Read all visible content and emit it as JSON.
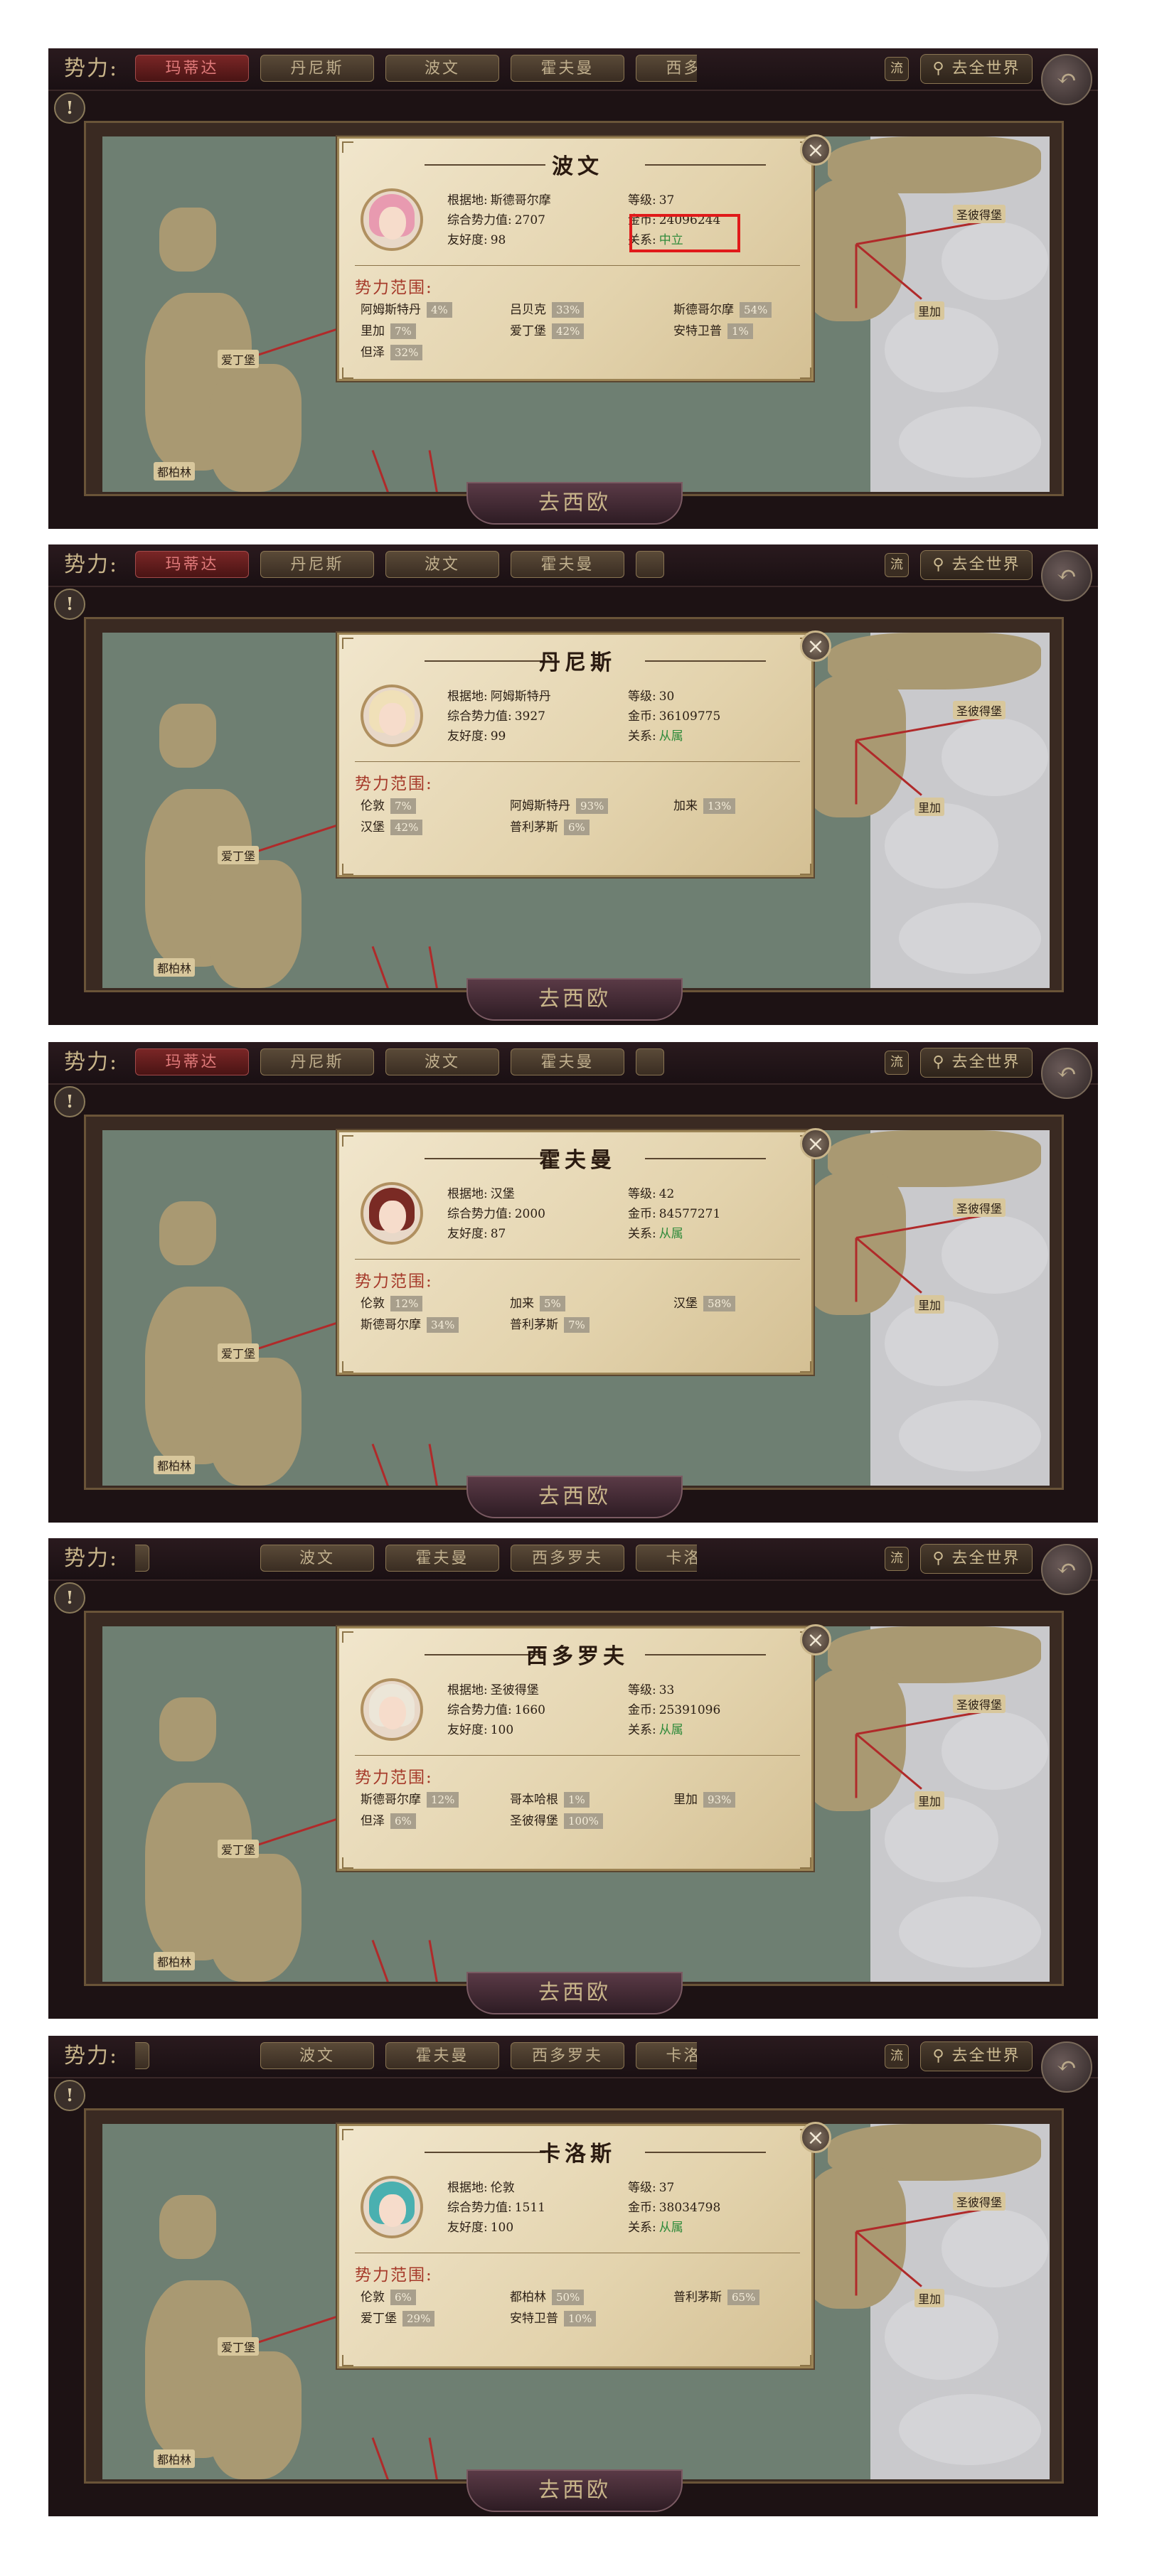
{
  "common": {
    "faction_label": "势力:",
    "small_btn": "流",
    "world_btn": "去全世界",
    "go_btn": "去西欧",
    "range_title": "势力范围:",
    "close_icon": "close-icon",
    "back_icon": "back-arrow-icon",
    "alert_icon": "alert-icon",
    "colors": {
      "relation": "#2e8a3a",
      "highlight": "#e01a1a",
      "active_tab": "#e07a7a"
    }
  },
  "map_labels": [
    "爱丁堡",
    "都柏林",
    "圣彼得堡",
    "里加"
  ],
  "panels": [
    {
      "tabs": [
        {
          "label": "玛蒂达",
          "active": true
        },
        {
          "label": "丹尼斯"
        },
        {
          "label": "波文"
        },
        {
          "label": "霍夫曼"
        },
        {
          "label": "西多罗"
        }
      ],
      "dialog": {
        "name": "波文",
        "base_label": "根据地:",
        "base": "斯德哥尔摩",
        "power_label": "综合势力值:",
        "power": "2707",
        "friend_label": "友好度:",
        "friend": "98",
        "level_label": "等级:",
        "level": "37",
        "gold_label": "金币:",
        "gold": "24096244",
        "relation_label": "关系:",
        "relation": "中立",
        "highlight_relation": true,
        "ranges": [
          {
            "name": "阿姆斯特丹",
            "pct": "4%"
          },
          {
            "name": "吕贝克",
            "pct": "33%"
          },
          {
            "name": "斯德哥尔摩",
            "pct": "54%"
          },
          {
            "name": "里加",
            "pct": "7%"
          },
          {
            "name": "爱丁堡",
            "pct": "42%"
          },
          {
            "name": "安特卫普",
            "pct": "1%"
          },
          {
            "name": "但泽",
            "pct": "32%"
          }
        ]
      }
    },
    {
      "tabs": [
        {
          "label": "玛蒂达",
          "active": true
        },
        {
          "label": "丹尼斯"
        },
        {
          "label": "波文"
        },
        {
          "label": "霍夫曼"
        },
        {
          "label": ""
        }
      ],
      "dialog": {
        "name": "丹尼斯",
        "base_label": "根据地:",
        "base": "阿姆斯特丹",
        "power_label": "综合势力值:",
        "power": "3927",
        "friend_label": "友好度:",
        "friend": "99",
        "level_label": "等级:",
        "level": "30",
        "gold_label": "金币:",
        "gold": "36109775",
        "relation_label": "关系:",
        "relation": "从属",
        "highlight_relation": false,
        "ranges": [
          {
            "name": "伦敦",
            "pct": "7%"
          },
          {
            "name": "阿姆斯特丹",
            "pct": "93%"
          },
          {
            "name": "加来",
            "pct": "13%"
          },
          {
            "name": "汉堡",
            "pct": "42%"
          },
          {
            "name": "普利茅斯",
            "pct": "6%"
          }
        ]
      }
    },
    {
      "tabs": [
        {
          "label": "玛蒂达",
          "active": true
        },
        {
          "label": "丹尼斯"
        },
        {
          "label": "波文"
        },
        {
          "label": "霍夫曼"
        },
        {
          "label": ""
        }
      ],
      "dialog": {
        "name": "霍夫曼",
        "base_label": "根据地:",
        "base": "汉堡",
        "power_label": "综合势力值:",
        "power": "2000",
        "friend_label": "友好度:",
        "friend": "87",
        "level_label": "等级:",
        "level": "42",
        "gold_label": "金币:",
        "gold": "84577271",
        "relation_label": "关系:",
        "relation": "从属",
        "highlight_relation": false,
        "ranges": [
          {
            "name": "伦敦",
            "pct": "12%"
          },
          {
            "name": "加来",
            "pct": "5%"
          },
          {
            "name": "汉堡",
            "pct": "58%"
          },
          {
            "name": "斯德哥尔摩",
            "pct": "34%"
          },
          {
            "name": "普利茅斯",
            "pct": "7%"
          }
        ]
      }
    },
    {
      "tabs": [
        {
          "label": ""
        },
        {
          "label": "波文"
        },
        {
          "label": "霍夫曼"
        },
        {
          "label": "西多罗夫"
        },
        {
          "label": "卡洛斯"
        }
      ],
      "dialog": {
        "name": "西多罗夫",
        "base_label": "根据地:",
        "base": "圣彼得堡",
        "power_label": "综合势力值:",
        "power": "1660",
        "friend_label": "友好度:",
        "friend": "100",
        "level_label": "等级:",
        "level": "33",
        "gold_label": "金币:",
        "gold": "25391096",
        "relation_label": "关系:",
        "relation": "从属",
        "highlight_relation": false,
        "ranges": [
          {
            "name": "斯德哥尔摩",
            "pct": "12%"
          },
          {
            "name": "哥本哈根",
            "pct": "1%"
          },
          {
            "name": "里加",
            "pct": "93%"
          },
          {
            "name": "但泽",
            "pct": "6%"
          },
          {
            "name": "圣彼得堡",
            "pct": "100%"
          }
        ]
      }
    },
    {
      "tabs": [
        {
          "label": ""
        },
        {
          "label": "波文"
        },
        {
          "label": "霍夫曼"
        },
        {
          "label": "西多罗夫"
        },
        {
          "label": "卡洛斯"
        }
      ],
      "dialog": {
        "name": "卡洛斯",
        "base_label": "根据地:",
        "base": "伦敦",
        "power_label": "综合势力值:",
        "power": "1511",
        "friend_label": "友好度:",
        "friend": "100",
        "level_label": "等级:",
        "level": "37",
        "gold_label": "金币:",
        "gold": "38034798",
        "relation_label": "关系:",
        "relation": "从属",
        "highlight_relation": false,
        "ranges": [
          {
            "name": "伦敦",
            "pct": "6%"
          },
          {
            "name": "都柏林",
            "pct": "50%"
          },
          {
            "name": "普利茅斯",
            "pct": "65%"
          },
          {
            "name": "爱丁堡",
            "pct": "29%"
          },
          {
            "name": "安特卫普",
            "pct": "10%"
          }
        ]
      }
    }
  ]
}
